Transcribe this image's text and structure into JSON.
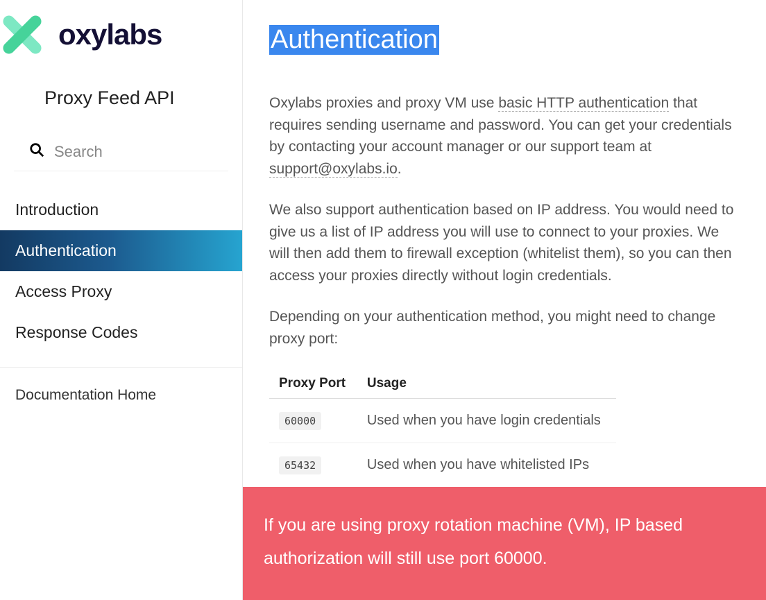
{
  "brand": {
    "name": "oxylabs"
  },
  "api_title": "Proxy Feed API",
  "search": {
    "placeholder": "Search"
  },
  "nav": {
    "items": [
      {
        "label": "Introduction",
        "active": false
      },
      {
        "label": "Authentication",
        "active": true
      },
      {
        "label": "Access Proxy",
        "active": false
      },
      {
        "label": "Response Codes",
        "active": false
      }
    ],
    "home": "Documentation Home"
  },
  "page": {
    "title": "Authentication",
    "p1_a": "Oxylabs proxies and proxy VM use ",
    "p1_link1": "basic HTTP authentication",
    "p1_b": " that requires sending username and password. You can get your credentials by contacting your account manager or our support team at ",
    "p1_link2": "support@oxylabs.io",
    "p1_c": ".",
    "p2": "We also support authentication based on IP address. You would need to give us a list of IP address you will use to connect to your proxies. We will then add them to firewall exception (whitelist them), so you can then access your proxies directly without login credentials.",
    "p3": "Depending on your authentication method, you might need to change proxy port:",
    "table": {
      "headers": [
        "Proxy Port",
        "Usage"
      ],
      "rows": [
        {
          "port": "60000",
          "usage": "Used when you have login credentials"
        },
        {
          "port": "65432",
          "usage": "Used when you have whitelisted IPs"
        }
      ]
    },
    "callout": "If you are using proxy rotation machine (VM), IP based authorization will still use port 60000."
  }
}
